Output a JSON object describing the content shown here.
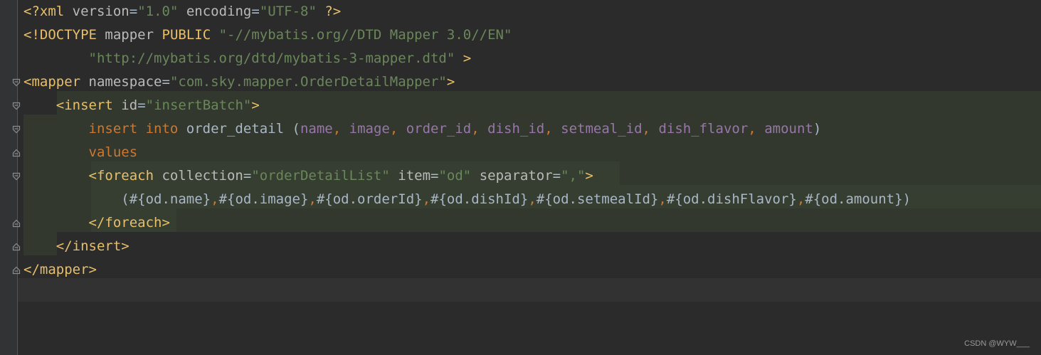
{
  "watermark": "CSDN @WYW___",
  "code_lines": [
    [
      {
        "c": "t-tag",
        "t": "<?xml"
      },
      {
        "c": "t-plain",
        "t": " "
      },
      {
        "c": "t-attr",
        "t": "version"
      },
      {
        "c": "t-plain",
        "t": "="
      },
      {
        "c": "t-str",
        "t": "\"1.0\""
      },
      {
        "c": "t-plain",
        "t": " "
      },
      {
        "c": "t-attr",
        "t": "encoding"
      },
      {
        "c": "t-plain",
        "t": "="
      },
      {
        "c": "t-str",
        "t": "\"UTF-8\""
      },
      {
        "c": "t-plain",
        "t": " "
      },
      {
        "c": "t-tag",
        "t": "?>"
      }
    ],
    [
      {
        "c": "t-tag",
        "t": "<!DOCTYPE"
      },
      {
        "c": "t-plain",
        "t": " "
      },
      {
        "c": "t-attr",
        "t": "mapper"
      },
      {
        "c": "t-plain",
        "t": " "
      },
      {
        "c": "t-tag",
        "t": "PUBLIC"
      },
      {
        "c": "t-plain",
        "t": " "
      },
      {
        "c": "t-str",
        "t": "\"-//mybatis.org//DTD Mapper 3.0//EN\""
      }
    ],
    [
      {
        "c": "t-plain",
        "t": "        "
      },
      {
        "c": "t-str",
        "t": "\"http://mybatis.org/dtd/mybatis-3-mapper.dtd\""
      },
      {
        "c": "t-plain",
        "t": " "
      },
      {
        "c": "t-tag",
        "t": ">"
      }
    ],
    [
      {
        "c": "t-tag",
        "t": "<mapper"
      },
      {
        "c": "t-plain",
        "t": " "
      },
      {
        "c": "t-attr",
        "t": "namespace"
      },
      {
        "c": "t-plain",
        "t": "="
      },
      {
        "c": "t-str",
        "t": "\"com.sky.mapper.OrderDetailMapper\""
      },
      {
        "c": "t-tag",
        "t": ">"
      }
    ],
    [
      {
        "c": "t-plain",
        "t": "    "
      },
      {
        "c": "t-tag",
        "t": "<insert"
      },
      {
        "c": "t-plain",
        "t": " "
      },
      {
        "c": "t-attr",
        "t": "id"
      },
      {
        "c": "t-plain",
        "t": "="
      },
      {
        "c": "t-str",
        "t": "\"insertBatch\""
      },
      {
        "c": "t-tag",
        "t": ">"
      }
    ],
    [
      {
        "c": "t-plain",
        "t": "        "
      },
      {
        "c": "t-kw",
        "t": "insert into"
      },
      {
        "c": "t-plain",
        "t": " order_detail ("
      },
      {
        "c": "t-field",
        "t": "name"
      },
      {
        "c": "t-kw",
        "t": ","
      },
      {
        "c": "t-plain",
        "t": " "
      },
      {
        "c": "t-field",
        "t": "image"
      },
      {
        "c": "t-kw",
        "t": ","
      },
      {
        "c": "t-plain",
        "t": " "
      },
      {
        "c": "t-field",
        "t": "order_id"
      },
      {
        "c": "t-kw",
        "t": ","
      },
      {
        "c": "t-plain",
        "t": " "
      },
      {
        "c": "t-field",
        "t": "dish_id"
      },
      {
        "c": "t-kw",
        "t": ","
      },
      {
        "c": "t-plain",
        "t": " "
      },
      {
        "c": "t-field",
        "t": "setmeal_id"
      },
      {
        "c": "t-kw",
        "t": ","
      },
      {
        "c": "t-plain",
        "t": " "
      },
      {
        "c": "t-field",
        "t": "dish_flavor"
      },
      {
        "c": "t-kw",
        "t": ","
      },
      {
        "c": "t-plain",
        "t": " "
      },
      {
        "c": "t-field",
        "t": "amount"
      },
      {
        "c": "t-plain",
        "t": ")"
      }
    ],
    [
      {
        "c": "t-plain",
        "t": "        "
      },
      {
        "c": "t-kw",
        "t": "values"
      }
    ],
    [
      {
        "c": "t-plain",
        "t": "        "
      },
      {
        "c": "t-tag",
        "t": "<foreach"
      },
      {
        "c": "t-plain",
        "t": " "
      },
      {
        "c": "t-attr",
        "t": "collection"
      },
      {
        "c": "t-plain",
        "t": "="
      },
      {
        "c": "t-str",
        "t": "\"orderDetailList\""
      },
      {
        "c": "t-plain",
        "t": " "
      },
      {
        "c": "t-attr",
        "t": "item"
      },
      {
        "c": "t-plain",
        "t": "="
      },
      {
        "c": "t-str",
        "t": "\"od\""
      },
      {
        "c": "t-plain",
        "t": " "
      },
      {
        "c": "t-attr",
        "t": "separator"
      },
      {
        "c": "t-plain",
        "t": "="
      },
      {
        "c": "t-str",
        "t": "\",\""
      },
      {
        "c": "t-tag",
        "t": ">"
      }
    ],
    [
      {
        "c": "t-plain",
        "t": "            (#{od.name}"
      },
      {
        "c": "t-kw",
        "t": ","
      },
      {
        "c": "t-plain",
        "t": "#{od.image}"
      },
      {
        "c": "t-kw",
        "t": ","
      },
      {
        "c": "t-plain",
        "t": "#{od.orderId}"
      },
      {
        "c": "t-kw",
        "t": ","
      },
      {
        "c": "t-plain",
        "t": "#{od.dishId}"
      },
      {
        "c": "t-kw",
        "t": ","
      },
      {
        "c": "t-plain",
        "t": "#{od.setmealId}"
      },
      {
        "c": "t-kw",
        "t": ","
      },
      {
        "c": "t-plain",
        "t": "#{od.dishFlavor}"
      },
      {
        "c": "t-kw",
        "t": ","
      },
      {
        "c": "t-plain",
        "t": "#{od.amount})"
      }
    ],
    [
      {
        "c": "t-plain",
        "t": "        "
      },
      {
        "c": "t-tag",
        "t": "</foreach>"
      }
    ],
    [
      {
        "c": "t-plain",
        "t": "    "
      },
      {
        "c": "t-tag",
        "t": "</insert>"
      }
    ],
    [
      {
        "c": "t-tag",
        "t": "</mapper>"
      }
    ],
    []
  ],
  "fold_markers": [
    {
      "line": 3,
      "kind": "open"
    },
    {
      "line": 4,
      "kind": "open"
    },
    {
      "line": 5,
      "kind": "open"
    },
    {
      "line": 6,
      "kind": "close"
    },
    {
      "line": 7,
      "kind": "open"
    },
    {
      "line": 9,
      "kind": "close"
    },
    {
      "line": 10,
      "kind": "close"
    },
    {
      "line": 11,
      "kind": "close"
    }
  ]
}
